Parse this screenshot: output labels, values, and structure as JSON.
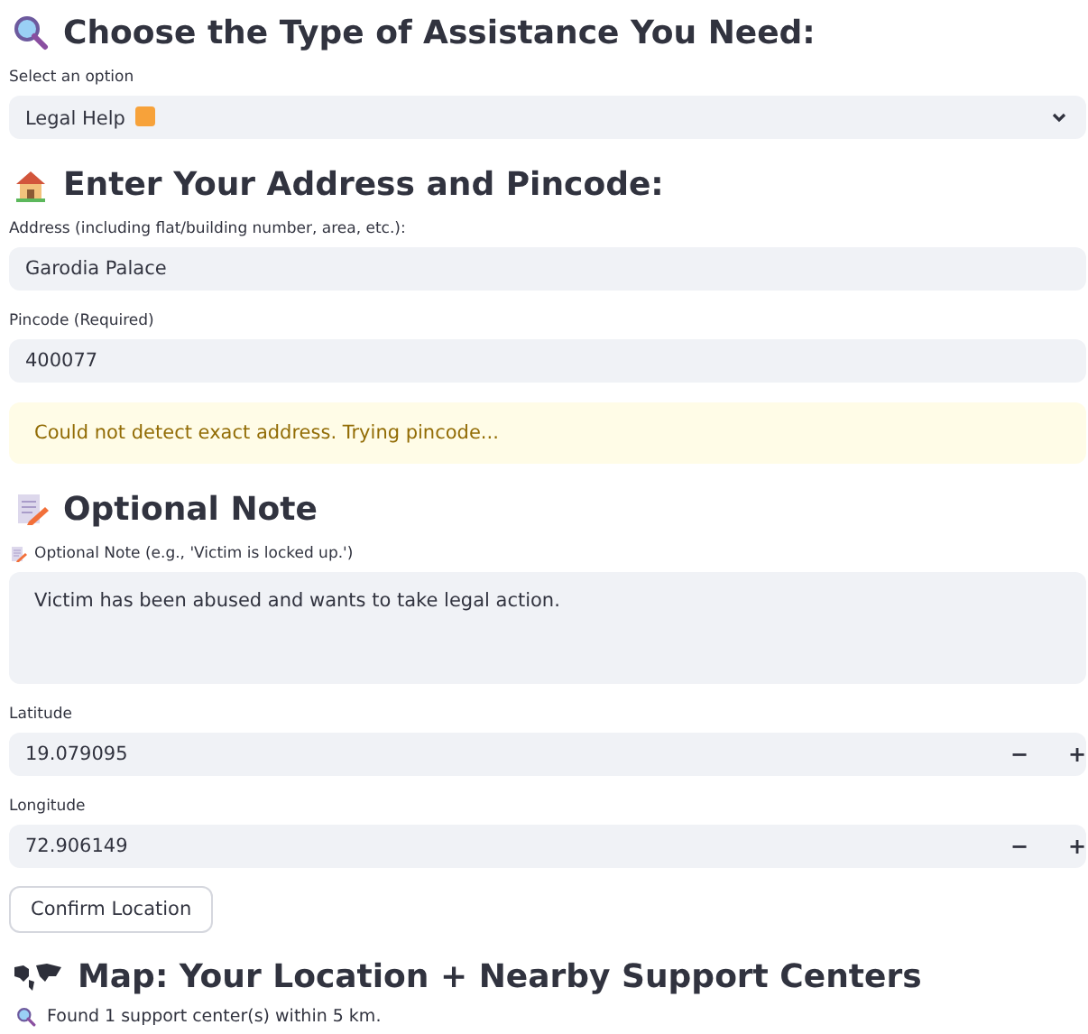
{
  "sections": [
    {
      "kind": "select",
      "heading": "Choose the Type of Assistance You Need:",
      "label": "Select an option",
      "value": "Legal Help"
    },
    {
      "kind": "address",
      "heading": "Enter Your Address and Pincode:",
      "fields": [
        {
          "label": "Address (including flat/building number, area, etc.):",
          "value": "Garodia Palace"
        },
        {
          "label": "Pincode (Required)",
          "value": "400077"
        }
      ],
      "warning": "Could not detect exact address. Trying pincode..."
    },
    {
      "kind": "note",
      "heading": "Optional Note",
      "label": "Optional Note (e.g., 'Victim is locked up.')",
      "value": "Victim has been abused and wants to take legal action."
    },
    {
      "kind": "coords",
      "fields": [
        {
          "label": "Latitude",
          "value": "19.079095",
          "minus": "−",
          "plus": "+"
        },
        {
          "label": "Longitude",
          "value": "72.906149",
          "minus": "−",
          "plus": "+"
        }
      ],
      "button": "Confirm Location"
    },
    {
      "kind": "map",
      "heading": "Map: Your Location + Nearby Support Centers",
      "info": "Found 1 support center(s) within 5 km."
    }
  ]
}
